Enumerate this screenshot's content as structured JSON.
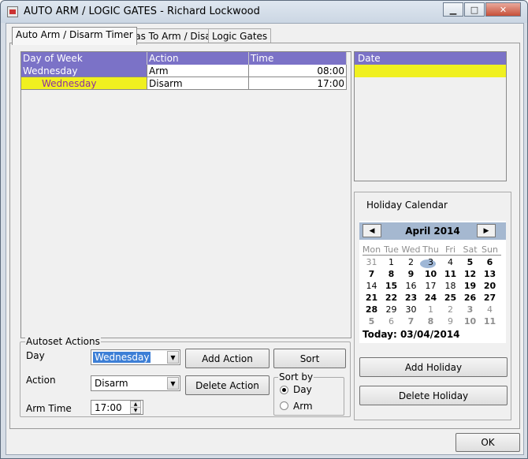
{
  "window": {
    "title": "AUTO ARM / LOGIC GATES - Richard Lockwood",
    "minimize_glyph": "▁",
    "maximize_glyph": "□",
    "close_glyph": "✕"
  },
  "tabs": [
    {
      "label": "Auto Arm / Disarm Timer",
      "active": true
    },
    {
      "label": "Areas To Arm / Disarm",
      "active": false
    },
    {
      "label": "Logic Gates",
      "active": false
    }
  ],
  "schedule_grid": {
    "columns": [
      "Day of Week",
      "Action",
      "Time"
    ],
    "rows": [
      {
        "day": "Wednesday",
        "action": "Arm",
        "time": "08:00"
      },
      {
        "day": "Wednesday",
        "action": "Disarm",
        "time": "17:00"
      }
    ]
  },
  "date_list": {
    "header": "Date"
  },
  "holiday": {
    "panel_title": "Holiday Calendar",
    "month_label": "April 2014",
    "prev_glyph": "◀",
    "next_glyph": "▶",
    "dow": [
      "Mon",
      "Tue",
      "Wed",
      "Thu",
      "Fri",
      "Sat",
      "Sun"
    ],
    "weeks": [
      [
        "31",
        "1",
        "2",
        "3",
        "4",
        "5",
        "6"
      ],
      [
        "7",
        "8",
        "9",
        "10",
        "11",
        "12",
        "13"
      ],
      [
        "14",
        "15",
        "16",
        "17",
        "18",
        "19",
        "20"
      ],
      [
        "21",
        "22",
        "23",
        "24",
        "25",
        "26",
        "27"
      ],
      [
        "28",
        "29",
        "30",
        "1",
        "2",
        "3",
        "4"
      ],
      [
        "5",
        "6",
        "7",
        "8",
        "9",
        "10",
        "11"
      ]
    ],
    "today_label": "Today: 03/04/2014",
    "add_label": "Add Holiday",
    "delete_label": "Delete Holiday"
  },
  "autoset": {
    "title": "Autoset Actions",
    "day_label": "Day",
    "day_value": "Wednesday",
    "action_label": "Action",
    "action_value": "Disarm",
    "time_label": "Arm Time",
    "time_value": "17:00",
    "add_action_label": "Add Action",
    "delete_action_label": "Delete Action",
    "sort_label": "Sort",
    "sortby_title": "Sort by",
    "sort_options": [
      {
        "label": "Day",
        "selected": true
      },
      {
        "label": "Arm",
        "selected": false
      }
    ]
  },
  "footer": {
    "ok_label": "OK"
  },
  "colors": {
    "grid_header": "#7b72c7",
    "selected_row": "#f0f020",
    "selected_row_text": "#8b2fa0",
    "combo_selected": "#3d7fd6"
  }
}
